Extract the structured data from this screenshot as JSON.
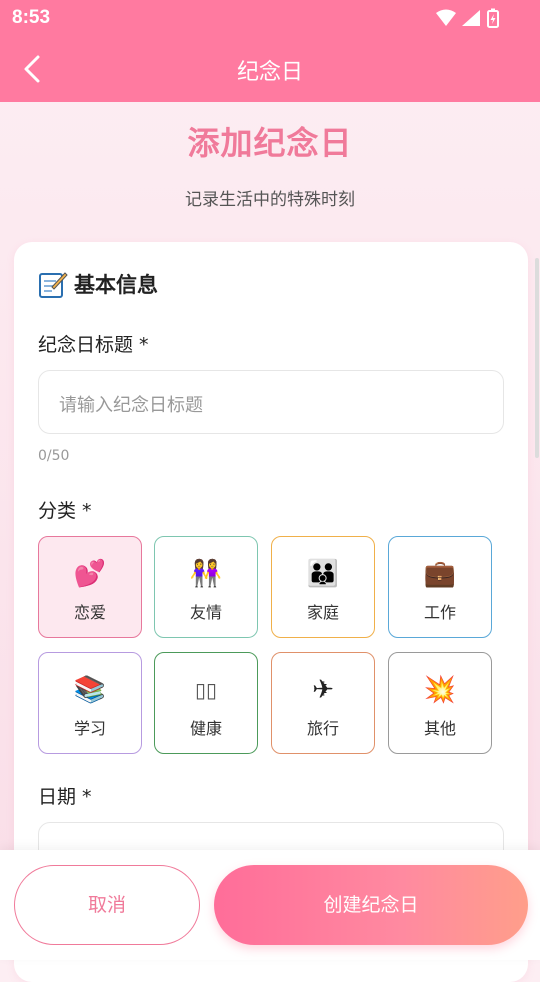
{
  "status_bar": {
    "time": "8:53"
  },
  "app_bar": {
    "title": "纪念日"
  },
  "hero": {
    "title": "添加纪念日",
    "subtitle": "记录生活中的特殊时刻"
  },
  "section": {
    "icon": "memo-icon",
    "title": "基本信息"
  },
  "title_field": {
    "label": "纪念日标题 *",
    "placeholder": "请输入纪念日标题",
    "value": "",
    "counter": "0/50"
  },
  "category": {
    "label": "分类 *",
    "selected": "恋爱",
    "items": [
      {
        "label": "恋爱",
        "icon": "💕",
        "icon_name": "two-hearts-icon",
        "color": "#e7789c"
      },
      {
        "label": "友情",
        "icon": "👭",
        "icon_name": "friends-icon",
        "color": "#7ec6b0"
      },
      {
        "label": "家庭",
        "icon": "👪",
        "icon_name": "family-icon",
        "color": "#f0b04a"
      },
      {
        "label": "工作",
        "icon": "💼",
        "icon_name": "briefcase-icon",
        "color": "#5aa8d8"
      },
      {
        "label": "学习",
        "icon": "📚",
        "icon_name": "books-icon",
        "color": "#b79be0"
      },
      {
        "label": "健康",
        "icon": "▯▯",
        "icon_name": "health-icon",
        "color": "#4c9a5a"
      },
      {
        "label": "旅行",
        "icon": "✈",
        "icon_name": "airplane-icon",
        "color": "#e0916a"
      },
      {
        "label": "其他",
        "icon": "💥",
        "icon_name": "sparkle-icon",
        "color": "#9a9a9a"
      }
    ]
  },
  "date_field": {
    "label": "日期 *"
  },
  "buttons": {
    "cancel": "取消",
    "create": "创建纪念日"
  },
  "colors": {
    "primary": "#ff7aa0",
    "accent_text": "#f07a9a",
    "selected_bg": "#fde8ef"
  }
}
